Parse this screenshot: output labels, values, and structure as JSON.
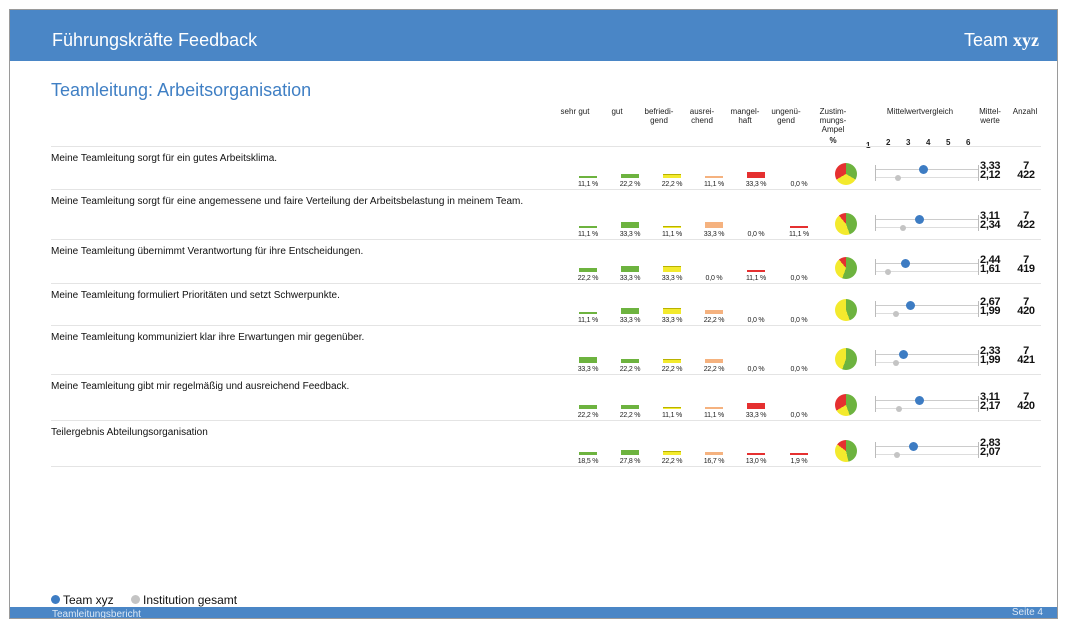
{
  "header": {
    "title": "Führungskräfte Feedback",
    "brand_prefix": "Team ",
    "brand_bold": "xyz"
  },
  "page_title": "Teamleitung: Arbeitsorganisation",
  "columns": {
    "c1": [
      "sehr gut"
    ],
    "c2": [
      "gut"
    ],
    "c3": [
      "befriedi-",
      "gend"
    ],
    "c4": [
      "ausrei-",
      "chend"
    ],
    "c5": [
      "mangel-",
      "haft"
    ],
    "c6": [
      "ungenü-",
      "gend"
    ],
    "c7": [
      "Zustim-",
      "mungs-",
      "Ampel",
      "%"
    ],
    "c8": [
      "Mittelwertvergleich"
    ],
    "c9": [
      "Mittel-",
      "werte"
    ],
    "c10": [
      "Anzahl"
    ]
  },
  "scale_labels": [
    "1",
    "2",
    "3",
    "4",
    "5",
    "6"
  ],
  "colors": {
    "sehr_gut": "#6db33f",
    "gut": "#6db33f",
    "befriedigend": "#f3ea2d",
    "ausreichend": "#f5b27f",
    "mangelhaft": "#e53030",
    "ungenuegend": "#e53030",
    "team": "#3d7cc3",
    "institution": "#c4c4c4",
    "header": "#4a86c6"
  },
  "rows": [
    {
      "question": "Meine Teamleitung sorgt für ein gutes Arbeitsklima.",
      "pcts": [
        "11,1 %",
        "22,2 %",
        "22,2 %",
        "11,1 %",
        "33,3 %",
        "0,0 %"
      ],
      "values": [
        11.1,
        22.2,
        22.2,
        11.1,
        33.3,
        0.0
      ],
      "ampel": {
        "green": 33.3,
        "yellow": 33.3,
        "red": 33.3
      },
      "mean_team": "3,33",
      "mean_inst": "2,12",
      "count_team": "7",
      "count_inst": "422",
      "team_value": 3.33,
      "inst_value": 2.12
    },
    {
      "question": "Meine Teamleitung sorgt für eine angemessene und faire Verteilung der Arbeitsbelastung in meinem Team.",
      "pcts": [
        "11,1 %",
        "33,3 %",
        "11,1 %",
        "33,3 %",
        "0,0 %",
        "11,1 %"
      ],
      "values": [
        11.1,
        33.3,
        11.1,
        33.3,
        0.0,
        11.1
      ],
      "ampel": {
        "green": 44.4,
        "yellow": 44.4,
        "red": 11.1
      },
      "mean_team": "3,11",
      "mean_inst": "2,34",
      "count_team": "7",
      "count_inst": "422",
      "team_value": 3.11,
      "inst_value": 2.34
    },
    {
      "question": "Meine Teamleitung übernimmt Verantwortung für ihre Entscheidungen.",
      "pcts": [
        "22,2 %",
        "33,3 %",
        "33,3 %",
        "0,0 %",
        "11,1 %",
        "0,0 %"
      ],
      "values": [
        22.2,
        33.3,
        33.3,
        0.0,
        11.1,
        0.0
      ],
      "ampel": {
        "green": 55.6,
        "yellow": 33.3,
        "red": 11.1
      },
      "mean_team": "2,44",
      "mean_inst": "1,61",
      "count_team": "7",
      "count_inst": "419",
      "team_value": 2.44,
      "inst_value": 1.61
    },
    {
      "question": "Meine Teamleitung formuliert Prioritäten und setzt Schwerpunkte.",
      "pcts": [
        "11,1 %",
        "33,3 %",
        "33,3 %",
        "22,2 %",
        "0,0 %",
        "0,0 %"
      ],
      "values": [
        11.1,
        33.3,
        33.3,
        22.2,
        0.0,
        0.0
      ],
      "ampel": {
        "green": 44.4,
        "yellow": 55.6,
        "red": 0.0
      },
      "mean_team": "2,67",
      "mean_inst": "1,99",
      "count_team": "7",
      "count_inst": "420",
      "team_value": 2.67,
      "inst_value": 1.99
    },
    {
      "question": "Meine Teamleitung kommuniziert klar ihre Erwartungen mir gegenüber.",
      "pcts": [
        "33,3 %",
        "22,2 %",
        "22,2 %",
        "22,2 %",
        "0,0 %",
        "0,0 %"
      ],
      "values": [
        33.3,
        22.2,
        22.2,
        22.2,
        0.0,
        0.0
      ],
      "ampel": {
        "green": 55.6,
        "yellow": 44.4,
        "red": 0.0
      },
      "mean_team": "2,33",
      "mean_inst": "1,99",
      "count_team": "7",
      "count_inst": "421",
      "team_value": 2.33,
      "inst_value": 1.99
    },
    {
      "question": "Meine Teamleitung gibt mir regelmäßig und ausreichend Feedback.",
      "pcts": [
        "22,2 %",
        "22,2 %",
        "11,1 %",
        "11,1 %",
        "33,3 %",
        "0,0 %"
      ],
      "values": [
        22.2,
        22.2,
        11.1,
        11.1,
        33.3,
        0.0
      ],
      "ampel": {
        "green": 44.4,
        "yellow": 22.2,
        "red": 33.3
      },
      "mean_team": "3,11",
      "mean_inst": "2,17",
      "count_team": "7",
      "count_inst": "420",
      "team_value": 3.11,
      "inst_value": 2.17
    },
    {
      "question": "Teilergebnis Abteilungsorganisation",
      "pcts": [
        "18,5 %",
        "27,8 %",
        "22,2 %",
        "16,7 %",
        "13,0 %",
        "1,9 %"
      ],
      "values": [
        18.5,
        27.8,
        22.2,
        16.7,
        13.0,
        1.9
      ],
      "ampel": {
        "green": 46.3,
        "yellow": 38.9,
        "red": 14.8
      },
      "mean_team": "2,83",
      "mean_inst": "2,07",
      "count_team": "",
      "count_inst": "",
      "team_value": 2.83,
      "inst_value": 2.07
    }
  ],
  "legend": {
    "team": "Team xyz",
    "institution": "Institution gesamt"
  },
  "footer": {
    "left": "Teamleitungsbericht",
    "right": "Seite 4"
  }
}
